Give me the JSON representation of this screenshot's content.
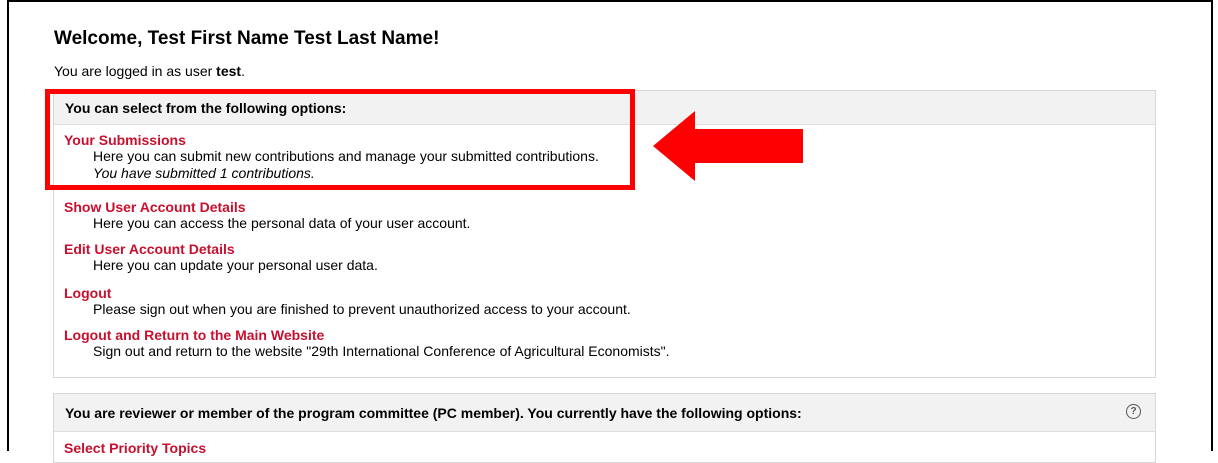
{
  "header": {
    "welcome": "Welcome, Test First Name Test Last Name!",
    "logged_prefix": "You are logged in as user ",
    "username": "test",
    "logged_suffix": "."
  },
  "options_panel": {
    "heading": "You can select from the following options:",
    "items": [
      {
        "title": "Your Submissions",
        "desc": "Here you can submit new contributions and manage your submitted contributions.",
        "note": "You have submitted 1 contributions."
      },
      {
        "title": "Show User Account Details",
        "desc": "Here you can access the personal data of your user account."
      },
      {
        "title": "Edit User Account Details",
        "desc": "Here you can update your personal user data."
      },
      {
        "title": "Logout",
        "desc": "Please sign out when you are finished to prevent unauthorized access to your account."
      },
      {
        "title": "Logout and Return to the Main Website",
        "desc": "Sign out and return to the website \"29th International Conference of Agricultural Economists\"."
      }
    ]
  },
  "pc_panel": {
    "heading": "You are reviewer or member of the program committee (PC member). You currently have the following options:",
    "help_icon": "question-circle-icon",
    "first_item": "Select Priority Topics"
  },
  "annotation": {
    "highlight_color": "#ff0000",
    "arrow_icon": "left-arrow-icon"
  },
  "colors": {
    "link": "#c8102e",
    "panel_header_bg": "#f2f2f2"
  }
}
